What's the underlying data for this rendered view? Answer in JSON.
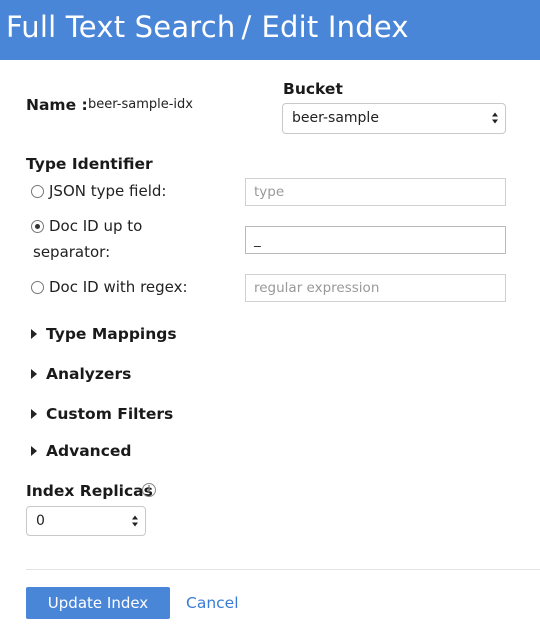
{
  "header": {
    "breadcrumb_parent": "Full Text Search",
    "separator": "/",
    "page_title": "Edit Index"
  },
  "name": {
    "label": "Name :",
    "value": "beer-sample-idx"
  },
  "bucket": {
    "label": "Bucket",
    "selected": "beer-sample"
  },
  "type_identifier": {
    "heading": "Type Identifier",
    "options": [
      {
        "label": "JSON type field:",
        "selected": false,
        "placeholder": "type",
        "value": ""
      },
      {
        "label_line1": "Doc ID up to",
        "label_line2": "separator:",
        "selected": true,
        "placeholder": "",
        "value": "_"
      },
      {
        "label": "Doc ID with regex:",
        "selected": false,
        "placeholder": "regular expression",
        "value": ""
      }
    ]
  },
  "sections": [
    {
      "label": "Type Mappings"
    },
    {
      "label": "Analyzers"
    },
    {
      "label": "Custom Filters"
    },
    {
      "label": "Advanced"
    }
  ],
  "replicas": {
    "label": "Index Replicas",
    "info_icon": "info-icon",
    "selected": "0"
  },
  "actions": {
    "update_label": "Update Index",
    "cancel_label": "Cancel"
  },
  "colors": {
    "accent": "#4a86d8",
    "link": "#3a7bd5"
  }
}
